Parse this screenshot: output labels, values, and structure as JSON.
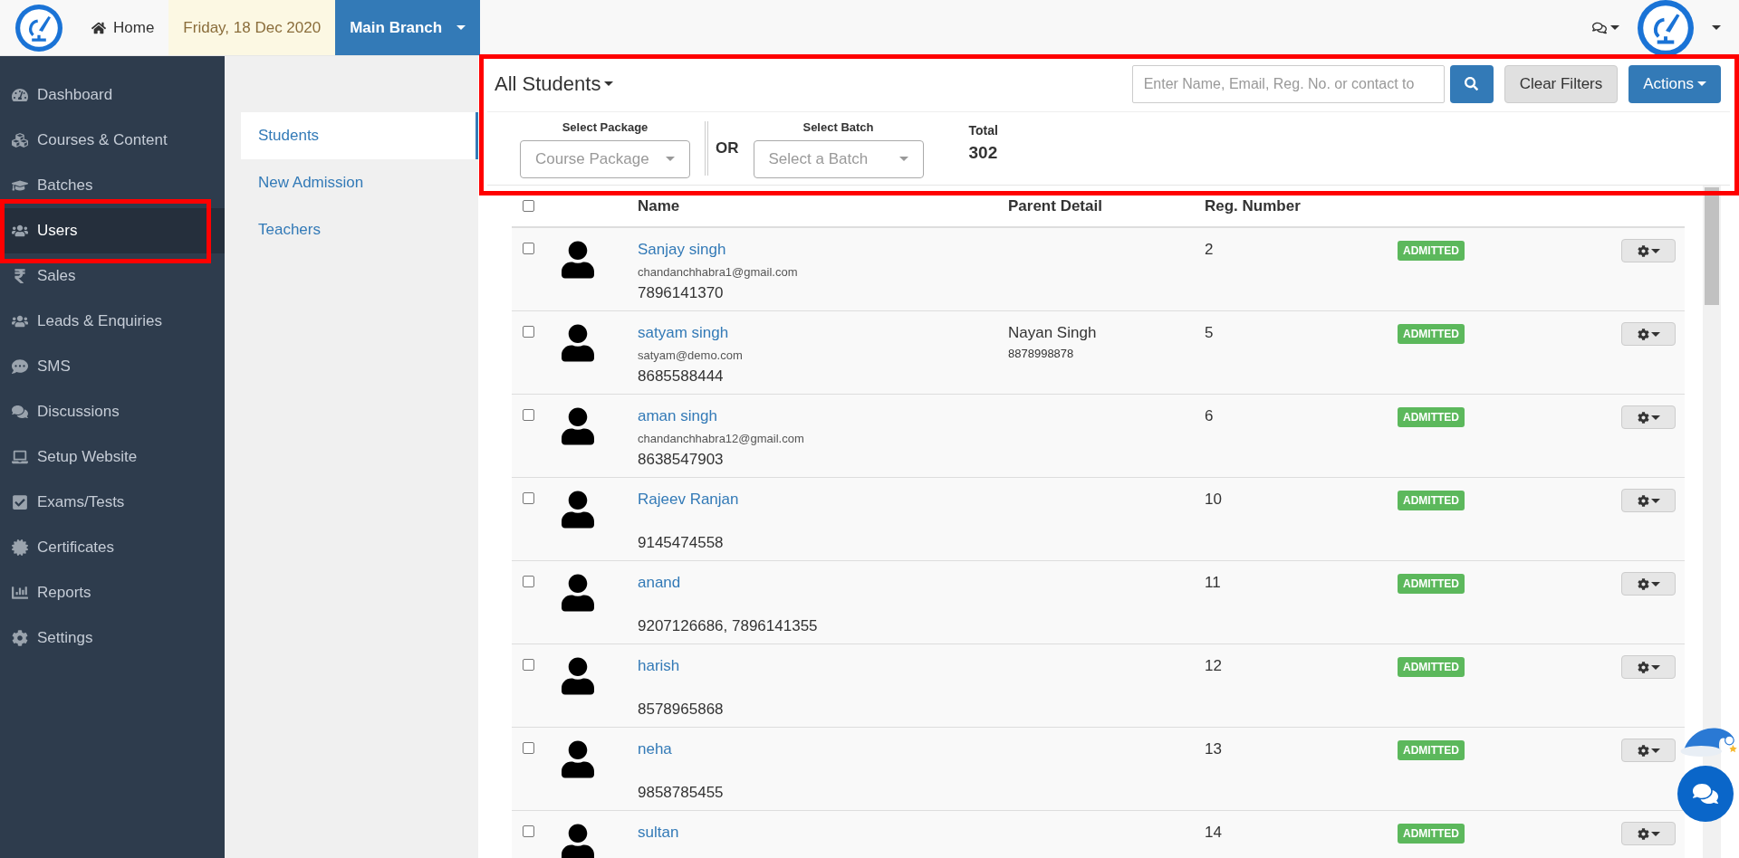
{
  "top_bar": {
    "home": "Home",
    "date": "Friday, 18 Dec 2020",
    "branch": "Main Branch"
  },
  "sidebar": {
    "items": [
      {
        "label": "Dashboard",
        "selected": false
      },
      {
        "label": "Courses & Content",
        "selected": false
      },
      {
        "label": "Batches",
        "selected": false
      },
      {
        "label": "Users",
        "selected": true
      },
      {
        "label": "Sales",
        "selected": false
      },
      {
        "label": "Leads & Enquiries",
        "selected": false
      },
      {
        "label": "SMS",
        "selected": false
      },
      {
        "label": "Discussions",
        "selected": false
      },
      {
        "label": "Setup Website",
        "selected": false
      },
      {
        "label": "Exams/Tests",
        "selected": false
      },
      {
        "label": "Certificates",
        "selected": false
      },
      {
        "label": "Reports",
        "selected": false
      },
      {
        "label": "Settings",
        "selected": false
      }
    ]
  },
  "sub_nav": {
    "items": [
      {
        "label": "Students",
        "selected": true
      },
      {
        "label": "New Admission",
        "selected": false
      },
      {
        "label": "Teachers",
        "selected": false
      }
    ]
  },
  "filters": {
    "view": "All Students",
    "search": {
      "placeholder": "Enter Name, Email, Reg. No. or contact to"
    },
    "clear": "Clear Filters",
    "actions": "Actions",
    "package": {
      "label": "Select Package",
      "placeholder": "Course Package"
    },
    "or": "OR",
    "batch": {
      "label": "Select Batch",
      "placeholder": "Select a Batch"
    },
    "total": {
      "label": "Total",
      "value": "302"
    }
  },
  "table": {
    "columns": [
      "Name",
      "Parent Detail",
      "Reg. Number"
    ],
    "all_checked": false,
    "rows": [
      {
        "checked": false,
        "name": "Sanjay singh",
        "email": "chandanchhabra1@gmail.com",
        "phone": "7896141370",
        "parent": "",
        "parent_phone": "",
        "reg": "2",
        "status": "ADMITTED"
      },
      {
        "checked": false,
        "name": "satyam singh",
        "email": "satyam@demo.com",
        "phone": "8685588444",
        "parent": "Nayan Singh",
        "parent_phone": "8878998878",
        "reg": "5",
        "status": "ADMITTED"
      },
      {
        "checked": false,
        "name": "aman singh",
        "email": "chandanchhabra12@gmail.com",
        "phone": "8638547903",
        "parent": "",
        "parent_phone": "",
        "reg": "6",
        "status": "ADMITTED"
      },
      {
        "checked": false,
        "name": "Rajeev Ranjan",
        "email": "",
        "phone": "9145474558",
        "parent": "",
        "parent_phone": "",
        "reg": "10",
        "status": "ADMITTED"
      },
      {
        "checked": false,
        "name": "anand",
        "email": "",
        "phone": "9207126686, 7896141355",
        "parent": "",
        "parent_phone": "",
        "reg": "11",
        "status": "ADMITTED"
      },
      {
        "checked": false,
        "name": "harish",
        "email": "",
        "phone": "8578965868",
        "parent": "",
        "parent_phone": "",
        "reg": "12",
        "status": "ADMITTED"
      },
      {
        "checked": false,
        "name": "neha",
        "email": "",
        "phone": "9858785455",
        "parent": "",
        "parent_phone": "",
        "reg": "13",
        "status": "ADMITTED"
      },
      {
        "checked": false,
        "name": "sultan",
        "email": "",
        "phone": "",
        "parent": "",
        "parent_phone": "",
        "reg": "14",
        "status": "ADMITTED"
      }
    ]
  }
}
